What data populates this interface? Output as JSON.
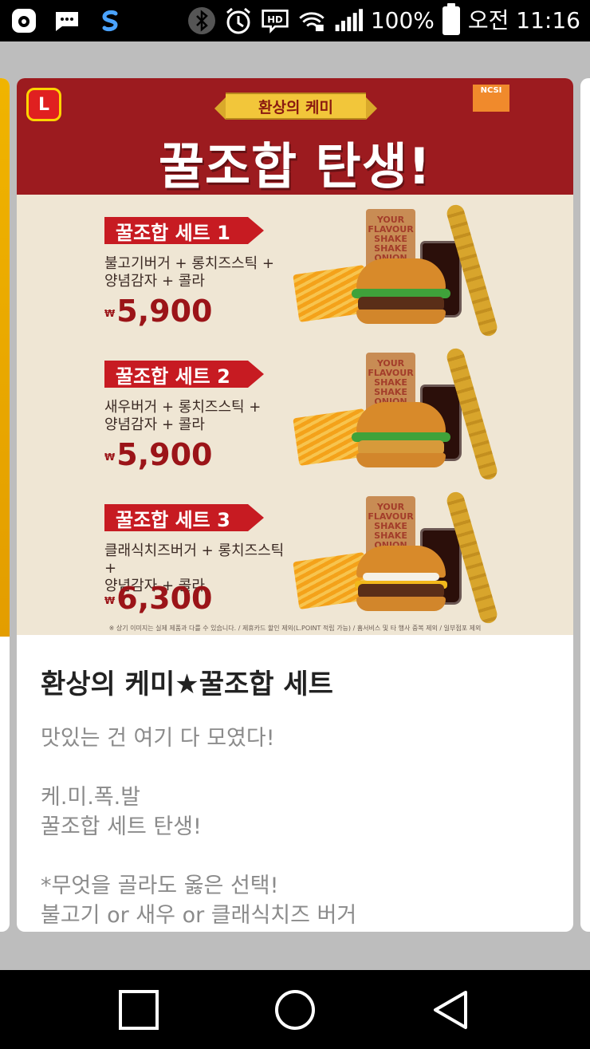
{
  "status_bar": {
    "icons_left": [
      "o-app-icon",
      "messages-icon",
      "s-app-icon"
    ],
    "icons_right": [
      "bluetooth-icon",
      "alarm-icon",
      "hd-voice-icon",
      "wifi-lock-icon",
      "signal-icon"
    ],
    "battery": "100%",
    "time": "오전 11:16"
  },
  "banner": {
    "logo_text": "L",
    "ncsi_label": "NCSI",
    "ribbon": "환상의 케미",
    "headline": "꿀조합 탄생!",
    "sets": [
      {
        "name": "꿀조합 세트 1",
        "desc": "불고기버거 + 롱치즈스틱 +\n양념감자 + 콜라",
        "price": "5,900",
        "burger": "bulgogi"
      },
      {
        "name": "꿀조합 세트 2",
        "desc": "새우버거 + 롱치즈스틱 +\n양념감자 + 콜라",
        "price": "5,900",
        "burger": "shrimp"
      },
      {
        "name": "꿀조합 세트 3",
        "desc": "클래식치즈버거 + 롱치즈스틱 +\n양념감자 + 콜라",
        "price": "6,300",
        "burger": "cheese"
      }
    ],
    "won_symbol": "₩",
    "bag_text": "YOUR FLAVOUR SHAKE SHAKE ONION",
    "disclaimer": "※ 상기 이미지는 실제 제품과 다를 수 있습니다. / 제휴카드 할인 제외(L.POINT 적립 가능) / 홈서비스 및 타 행사 중복 제외 / 일부점포 제외"
  },
  "card": {
    "title": "환상의 케미★꿀조합 세트",
    "lines": [
      "맛있는 건 여기 다 모였다!",
      "",
      "케.미.폭.발",
      "꿀조합 세트 탄생!",
      "",
      "*무엇을 골라도 옳은 선택!",
      "불고기 or 새우 or 클래식치즈 버거"
    ]
  },
  "nav": {
    "buttons": [
      "recent-apps",
      "home",
      "back"
    ]
  }
}
